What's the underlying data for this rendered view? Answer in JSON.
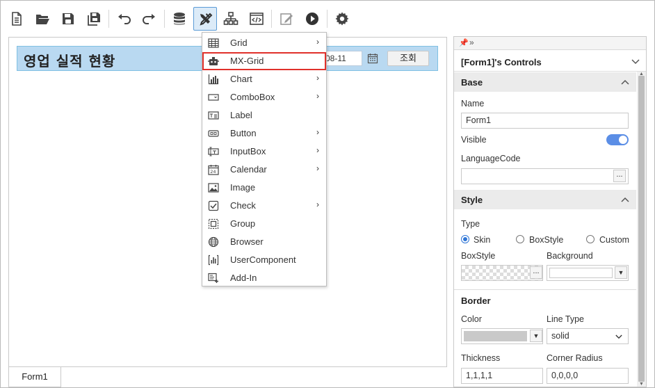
{
  "toolbar": {
    "buttons": [
      {
        "icon": "new-file-icon"
      },
      {
        "icon": "open-folder-icon"
      },
      {
        "icon": "save-icon"
      },
      {
        "icon": "save-all-icon"
      },
      {
        "icon": "undo-icon"
      },
      {
        "icon": "redo-icon"
      },
      {
        "icon": "database-icon"
      },
      {
        "icon": "tools-icon",
        "active": true
      },
      {
        "icon": "hierarchy-icon"
      },
      {
        "icon": "code-view-icon"
      },
      {
        "icon": "edit-icon"
      },
      {
        "icon": "run-icon"
      },
      {
        "icon": "settings-icon"
      }
    ]
  },
  "form": {
    "title": "영업 실적 현황",
    "date_value": "-08-11",
    "search_label": "조회"
  },
  "bottom_tabs": [
    "Form1"
  ],
  "menu": {
    "items": [
      {
        "label": "Grid",
        "icon": "grid-icon",
        "submenu": true
      },
      {
        "label": "MX-Grid",
        "icon": "mx-grid-icon",
        "submenu": false,
        "highlight": true
      },
      {
        "label": "Chart",
        "icon": "chart-icon",
        "submenu": true
      },
      {
        "label": "ComboBox",
        "icon": "combobox-icon",
        "submenu": true
      },
      {
        "label": "Label",
        "icon": "label-icon",
        "submenu": false
      },
      {
        "label": "Button",
        "icon": "button-icon",
        "submenu": true
      },
      {
        "label": "InputBox",
        "icon": "inputbox-icon",
        "submenu": true
      },
      {
        "label": "Calendar",
        "icon": "calendar-icon",
        "submenu": true
      },
      {
        "label": "Image",
        "icon": "image-icon",
        "submenu": false
      },
      {
        "label": "Check",
        "icon": "check-icon",
        "submenu": true
      },
      {
        "label": "Group",
        "icon": "group-icon",
        "submenu": false
      },
      {
        "label": "Browser",
        "icon": "globe-icon",
        "submenu": false
      },
      {
        "label": "UserComponent",
        "icon": "user-component-icon",
        "submenu": false
      },
      {
        "label": "Add-In",
        "icon": "add-in-icon",
        "submenu": false
      }
    ]
  },
  "panel": {
    "title": "[Form1]'s Controls",
    "base": {
      "header": "Base",
      "name_label": "Name",
      "name_value": "Form1",
      "visible_label": "Visible",
      "visible_on": true,
      "language_label": "LanguageCode",
      "language_value": "",
      "dots": "..."
    },
    "style": {
      "header": "Style",
      "type_label": "Type",
      "type_options": [
        "Skin",
        "BoxStyle",
        "Custom"
      ],
      "type_selected": "Skin",
      "boxstyle_label": "BoxStyle",
      "background_label": "Background",
      "dots": "..."
    },
    "border": {
      "header": "Border",
      "color_label": "Color",
      "color_value": "#c9c9c9",
      "linetype_label": "Line Type",
      "linetype_value": "solid",
      "thickness_label": "Thickness",
      "thickness_value": "1,1,1,1",
      "radius_label": "Corner Radius",
      "radius_value": "0,0,0,0"
    }
  }
}
